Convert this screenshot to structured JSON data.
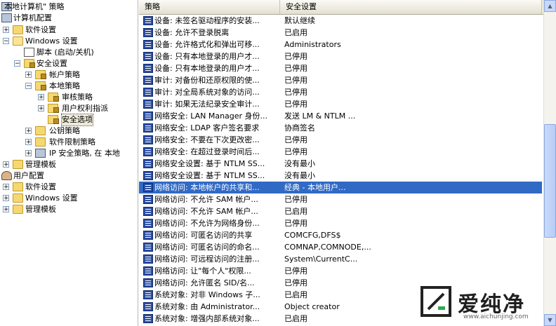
{
  "tree": {
    "root": "本地计算机\" 策略",
    "computer_config": "计算机配置",
    "software_settings": "软件设置",
    "windows_settings": "Windows 设置",
    "scripts": "脚本 (启动/关机)",
    "security_settings": "安全设置",
    "account_policies": "帐户策略",
    "local_policies": "本地策略",
    "audit_policy": "审核策略",
    "user_rights": "用户权利指派",
    "security_options": "安全选项",
    "public_key": "公钥策略",
    "software_restriction": "软件限制策略",
    "ip_security": "IP 安全策略, 在 本地",
    "admin_templates": "管理模板",
    "user_config": "用户配置",
    "user_software_settings": "软件设置",
    "user_windows_settings": "Windows 设置",
    "user_admin_templates": "管理模板"
  },
  "list": {
    "col_policy": "策略",
    "col_setting": "安全设置",
    "rows": [
      {
        "policy": "设备: 未签名驱动程序的安装...",
        "setting": "默认继续"
      },
      {
        "policy": "设备: 允许不登录脱离",
        "setting": "已启用"
      },
      {
        "policy": "设备: 允许格式化和弹出可移...",
        "setting": "Administrators"
      },
      {
        "policy": "设备: 只有本地登录的用户才...",
        "setting": "已停用"
      },
      {
        "policy": "设备: 只有本地登录的用户才...",
        "setting": "已停用"
      },
      {
        "policy": "审计: 对备份和还原权限的使...",
        "setting": "已停用"
      },
      {
        "policy": "审计: 对全局系统对象的访问...",
        "setting": "已停用"
      },
      {
        "policy": "审计: 如果无法纪录安全审计...",
        "setting": "已停用"
      },
      {
        "policy": "网络安全: LAN Manager 身份...",
        "setting": "发送 LM & NTLM ..."
      },
      {
        "policy": "网络安全: LDAP 客户签名要求",
        "setting": "协商签名"
      },
      {
        "policy": "网络安全: 不要在下次更改密...",
        "setting": "已停用"
      },
      {
        "policy": "网络安全: 在超过登录时间后...",
        "setting": "已停用"
      },
      {
        "policy": "网络安全设置: 基于 NTLM SS...",
        "setting": "没有最小"
      },
      {
        "policy": "网络安全设置: 基于 NTLM SS...",
        "setting": "没有最小"
      },
      {
        "policy": "网络访问: 本地帐户的共享和...",
        "setting": "经典 - 本地用户..."
      },
      {
        "policy": "网络访问: 不允许 SAM 帐户...",
        "setting": "已停用"
      },
      {
        "policy": "网络访问: 不允许 SAM 帐户...",
        "setting": "已启用"
      },
      {
        "policy": "网络访问: 不允许为网络身份...",
        "setting": "已停用"
      },
      {
        "policy": "网络访问: 可匿名访问的共享",
        "setting": "COMCFG,DFS$"
      },
      {
        "policy": "网络访问: 可匿名访问的命名...",
        "setting": "COMNAP,COMNODE,..."
      },
      {
        "policy": "网络访问: 可远程访问的注册...",
        "setting": "System\\CurrentC..."
      },
      {
        "policy": "网络访问: 让\"每个人\"权限...",
        "setting": "已停用"
      },
      {
        "policy": "网络访问: 允许匿名 SID/名...",
        "setting": "已停用"
      },
      {
        "policy": "系统对象: 对非 Windows 子...",
        "setting": "已启用"
      },
      {
        "policy": "系统对象: 由 Administrator...",
        "setting": "Object creator"
      },
      {
        "policy": "系统对象: 增强内部系统对象...",
        "setting": "已启用"
      }
    ]
  },
  "watermark": {
    "text": "爱纯净",
    "url": "www.aichunjing.com"
  }
}
